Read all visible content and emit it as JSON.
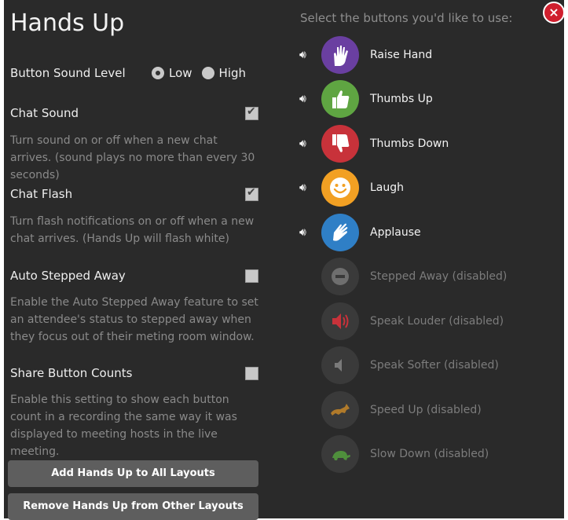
{
  "title": "Hands Up",
  "settings": {
    "sound_level": {
      "label": "Button Sound Level",
      "options": [
        "Low",
        "High"
      ],
      "selected": "Low"
    },
    "chat_sound": {
      "label": "Chat Sound",
      "checked": true,
      "desc": "Turn sound on or off when a new chat arrives. (sound plays no more than every 30 seconds)"
    },
    "chat_flash": {
      "label": "Chat Flash",
      "checked": true,
      "desc": "Turn flash notifications on or off when a new chat arrives. (Hands Up will flash white)"
    },
    "auto_away": {
      "label": "Auto Stepped Away",
      "checked": false,
      "desc": "Enable the Auto Stepped Away feature to set an attendee's status to stepped away when they focus out of their meting room window."
    },
    "share_counts": {
      "label": "Share Button Counts",
      "checked": false,
      "desc": "Enable this setting to show each button count in a recording the same way it was displayed to meeting hosts in the live meeting."
    }
  },
  "actions": {
    "add_label": "Add Hands Up to All Layouts",
    "remove_label": "Remove Hands Up from Other Layouts"
  },
  "close_label": "×",
  "right_heading": "Select the buttons you'd like to use:",
  "buttons": [
    {
      "label": "Raise Hand",
      "icon": "raise-hand-icon",
      "color": "#6a3fa1",
      "enabled": true
    },
    {
      "label": "Thumbs Up",
      "icon": "thumbs-up-icon",
      "color": "#5fa542",
      "enabled": true
    },
    {
      "label": "Thumbs Down",
      "icon": "thumbs-down-icon",
      "color": "#c8323a",
      "enabled": true
    },
    {
      "label": "Laugh",
      "icon": "laugh-icon",
      "color": "#f2a023",
      "enabled": true
    },
    {
      "label": "Applause",
      "icon": "applause-icon",
      "color": "#2f7fc6",
      "enabled": true
    },
    {
      "label": "Stepped Away (disabled)",
      "icon": "stepped-away-icon",
      "color": "#3a3a3a",
      "enabled": false
    },
    {
      "label": "Speak Louder (disabled)",
      "icon": "speak-louder-icon",
      "color": "#3a3a3a",
      "enabled": false
    },
    {
      "label": "Speak Softer (disabled)",
      "icon": "speak-softer-icon",
      "color": "#3a3a3a",
      "enabled": false
    },
    {
      "label": "Speed Up (disabled)",
      "icon": "speed-up-icon",
      "color": "#3a3a3a",
      "enabled": false
    },
    {
      "label": "Slow Down (disabled)",
      "icon": "slow-down-icon",
      "color": "#3a3a3a",
      "enabled": false
    }
  ]
}
